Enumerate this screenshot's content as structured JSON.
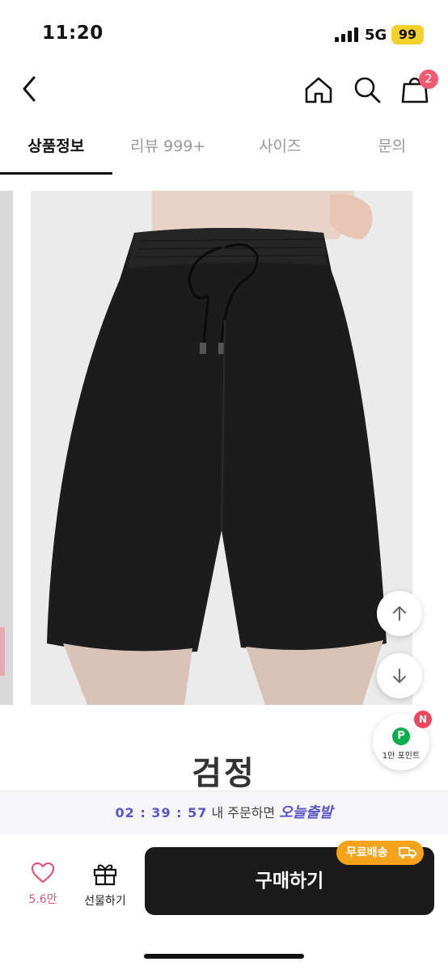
{
  "status_bar": {
    "time": "11:20",
    "network": "5G",
    "battery": "99"
  },
  "nav": {
    "cart_count": "2"
  },
  "tabs": [
    {
      "label": "상품정보",
      "active": true
    },
    {
      "label": "리뷰 999+",
      "active": false
    },
    {
      "label": "사이즈",
      "active": false
    },
    {
      "label": "문의",
      "active": false
    }
  ],
  "product": {
    "color_label": "검정"
  },
  "floating": {
    "points_icon": "P",
    "points_label": "1만 포인트",
    "points_badge": "N"
  },
  "timer": {
    "countdown": "02 : 39 : 57",
    "message": "내 주문하면",
    "highlight": "오늘출발"
  },
  "bottom_bar": {
    "like_count": "5.6만",
    "gift_label": "선물하기",
    "buy_label": "구매하기",
    "free_shipping_label": "무료배송"
  },
  "colors": {
    "accent_pink": "#e0567a",
    "timer_purple": "#5a55c9",
    "shipping_orange": "#f7a21b",
    "buy_button": "#1a1a1a"
  }
}
